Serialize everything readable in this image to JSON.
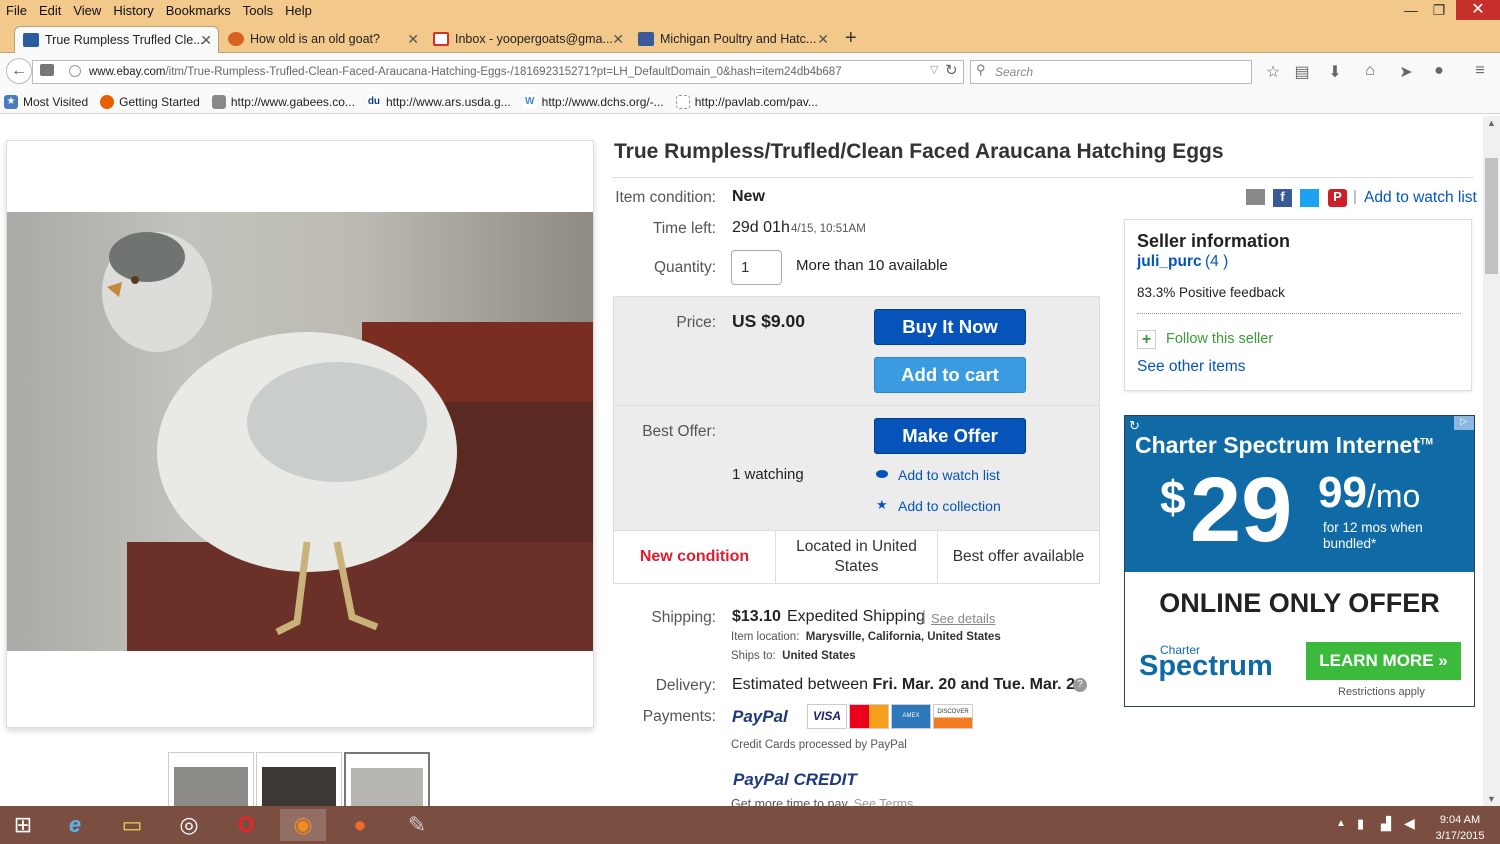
{
  "browser": {
    "menu": [
      "File",
      "Edit",
      "View",
      "History",
      "Bookmarks",
      "Tools",
      "Help"
    ],
    "window_controls": {
      "minimize": "—",
      "maximize": "❐",
      "close": "✕"
    },
    "tabs": [
      {
        "label": "True Rumpless Trufled Cle..."
      },
      {
        "label": "How old is an old goat?"
      },
      {
        "label": "Inbox - yoopergoats@gma..."
      },
      {
        "label": "Michigan Poultry and Hatc..."
      }
    ],
    "new_tab": "+",
    "url_domain": "www.ebay.com",
    "url_path": "/itm/True-Rumpless-Trufled-Clean-Faced-Araucana-Hatching-Eggs-/181692315271?pt=LH_DefaultDomain_0&hash=item24db4b687",
    "search_placeholder": "Search",
    "bookmarks": [
      {
        "label": "Most Visited",
        "icon": "star-icon"
      },
      {
        "label": "Getting Started",
        "icon": "firefox-icon"
      },
      {
        "label": "http://www.gabees.co...",
        "icon": "bird-icon"
      },
      {
        "label": "http://www.ars.usda.g...",
        "icon": "usda-icon"
      },
      {
        "label": "http://www.dchs.org/-...",
        "icon": "w-icon"
      },
      {
        "label": "http://pavlab.com/pav...",
        "icon": "page-icon"
      }
    ]
  },
  "item": {
    "title": "True Rumpless/Trufled/Clean Faced Araucana Hatching Eggs",
    "condition_label": "Item condition:",
    "condition": "New",
    "time_left_label": "Time left:",
    "time_left": "29d 01h",
    "time_left_end": "4/15, 10:51AM",
    "quantity_label": "Quantity:",
    "quantity": "1",
    "available": "More than 10 available",
    "price_label": "Price:",
    "price": "US $9.00",
    "buy_now": "Buy It Now",
    "add_to_cart": "Add to cart",
    "best_offer_label": "Best Offer:",
    "make_offer": "Make Offer",
    "watching": "1 watching",
    "add_watch": "Add to watch list",
    "add_collection": "Add to collection",
    "features": [
      "New condition",
      "Located in United States",
      "Best offer available"
    ],
    "shipping_label": "Shipping:",
    "shipping_price": "$13.10",
    "shipping_method": "Expedited Shipping",
    "see_details": "See details",
    "item_location_label": "Item location:",
    "item_location": "Marysville, California, United States",
    "ships_to_label": "Ships to:",
    "ships_to": "United States",
    "delivery_label": "Delivery:",
    "delivery_prefix": "Estimated between",
    "delivery_dates": "Fri. Mar. 20 and Tue. Mar. 24",
    "payments_label": "Payments:",
    "paypal": "PayPal",
    "cards": [
      "VISA",
      "MC",
      "AMEX",
      "DISCOVER"
    ],
    "credit_note": "Credit Cards processed by PayPal",
    "paypal_credit": "PayPal CREDIT",
    "credit_promo": "Get more time to pay.",
    "see_terms": "See Terms",
    "share_watch": "Add to watch list"
  },
  "seller": {
    "heading": "Seller information",
    "name": "juli_purc",
    "score": "(4 )",
    "feedback": "83.3% Positive feedback",
    "follow": "Follow this seller",
    "other_items": "See other items"
  },
  "ad": {
    "headline": "Charter Spectrum Internet",
    "tm": "TM",
    "dollar": "$",
    "price_main": "29",
    "price_cents": "99",
    "per": "/mo",
    "terms": "for 12 mos when bundled*",
    "offer": "ONLINE ONLY OFFER",
    "brand_small": "Charter",
    "brand": "Spectrum",
    "cta": "LEARN MORE »",
    "restrictions": "Restrictions apply"
  },
  "taskbar": {
    "time": "9:04 AM",
    "date": "3/17/2015"
  },
  "colors": {
    "ebay_blue": "#0654ba",
    "light_blue": "#3a9be0",
    "condition_red": "#dd1e31",
    "title_bar": "#f3c98b",
    "taskbar": "#7a4f42",
    "ad_blue": "#0f6aa6",
    "ad_green": "#3cba3c"
  }
}
